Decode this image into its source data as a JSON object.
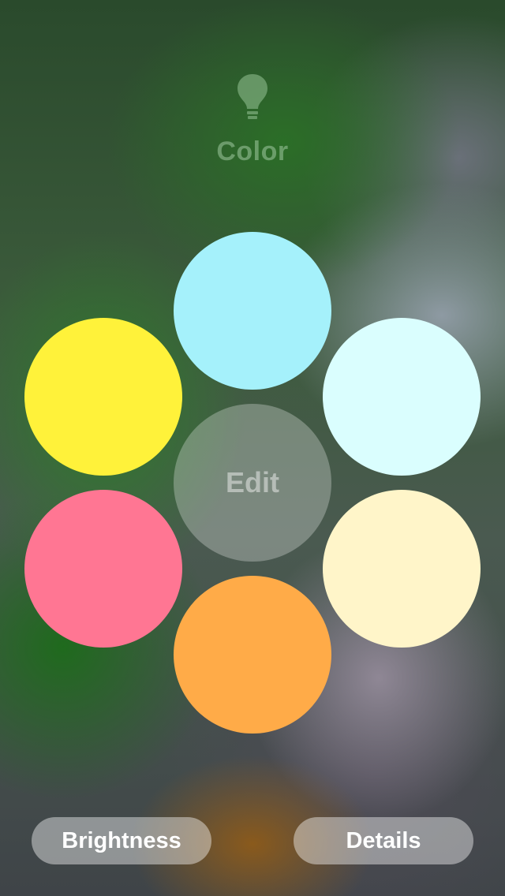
{
  "header": {
    "icon": "lightbulb-icon",
    "title": "Color"
  },
  "swatches": [
    {
      "name": "swatch-light-blue",
      "color": "#a5f1fb"
    },
    {
      "name": "swatch-pale-cyan",
      "color": "#dafefe"
    },
    {
      "name": "swatch-pale-yellow",
      "color": "#fff5c9"
    },
    {
      "name": "swatch-orange",
      "color": "#ffab48"
    },
    {
      "name": "swatch-pink",
      "color": "#ff7693"
    },
    {
      "name": "swatch-yellow",
      "color": "#fff23a"
    }
  ],
  "center": {
    "edit_label": "Edit"
  },
  "footer": {
    "brightness_label": "Brightness",
    "details_label": "Details"
  }
}
